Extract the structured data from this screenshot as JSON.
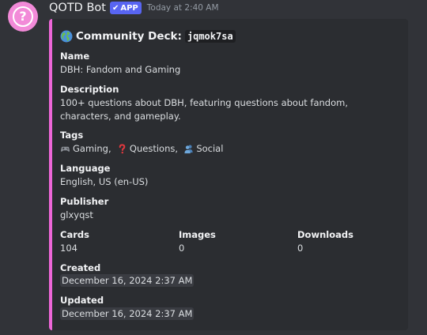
{
  "message": {
    "username": "QOTD Bot",
    "badge": "APP",
    "badge_check": "✔",
    "timestamp": "Today at 2:40 AM",
    "avatar_glyph": "?",
    "avatar_color": "#f28ad8"
  },
  "embed": {
    "accent_color": "#ee66d8",
    "title_prefix": "Community Deck:",
    "deck_code": "jqmok7sa",
    "fields": {
      "name": {
        "label": "Name",
        "value": "DBH: Fandom and Gaming"
      },
      "description": {
        "label": "Description",
        "value": "100+ questions about DBH, featuring questions about fandom, characters, and gameplay."
      },
      "tags": {
        "label": "Tags",
        "items": [
          {
            "icon": "gamepad-icon",
            "label": "Gaming"
          },
          {
            "icon": "question-mark-icon",
            "label": "Questions"
          },
          {
            "icon": "people-icon",
            "label": "Social"
          }
        ],
        "separator": ","
      },
      "language": {
        "label": "Language",
        "value": "English, US (en-US)"
      },
      "publisher": {
        "label": "Publisher",
        "value": "glxyqst"
      },
      "cards": {
        "label": "Cards",
        "value": "104"
      },
      "images": {
        "label": "Images",
        "value": "0"
      },
      "downloads": {
        "label": "Downloads",
        "value": "0"
      },
      "created": {
        "label": "Created",
        "value": "December 16, 2024 2:37 AM"
      },
      "updated": {
        "label": "Updated",
        "value": "December 16, 2024 2:37 AM"
      }
    }
  }
}
